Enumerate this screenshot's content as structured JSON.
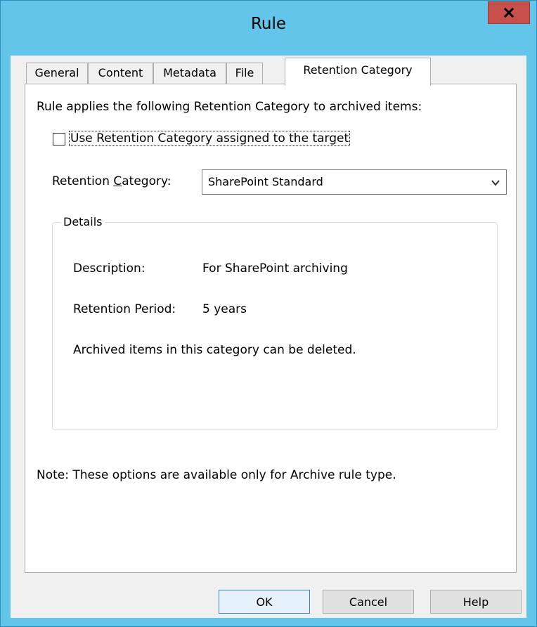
{
  "window": {
    "title": "Rule"
  },
  "tabs": [
    {
      "label": "General",
      "active": false
    },
    {
      "label": "Content",
      "active": false
    },
    {
      "label": "Metadata",
      "active": false
    },
    {
      "label": "File",
      "active": false
    },
    {
      "label": "Retention Category",
      "active": true
    }
  ],
  "retention": {
    "intro": "Rule applies the following Retention Category to archived items:",
    "use_target_checkbox": {
      "label": "Use Retention Category assigned to the target",
      "checked": false
    },
    "category_label_prefix": "Retention ",
    "category_label_accel": "C",
    "category_label_suffix": "ategory:",
    "category_selected": "SharePoint Standard",
    "details": {
      "legend": "Details",
      "description_label": "Description:",
      "description_value": "For SharePoint archiving",
      "period_label": "Retention Period:",
      "period_value": "5 years",
      "deletion_note": "Archived items in this category can be deleted."
    },
    "note": "Note: These options are available only for Archive rule type."
  },
  "buttons": {
    "ok": "OK",
    "cancel": "Cancel",
    "help": "Help"
  },
  "colors": {
    "titlebar": "#63c5ea",
    "close_button": "#c7504b",
    "client_bg": "#f0f0f0"
  },
  "icons": {
    "close": "close-x-icon",
    "dropdown": "chevron-down-icon"
  }
}
